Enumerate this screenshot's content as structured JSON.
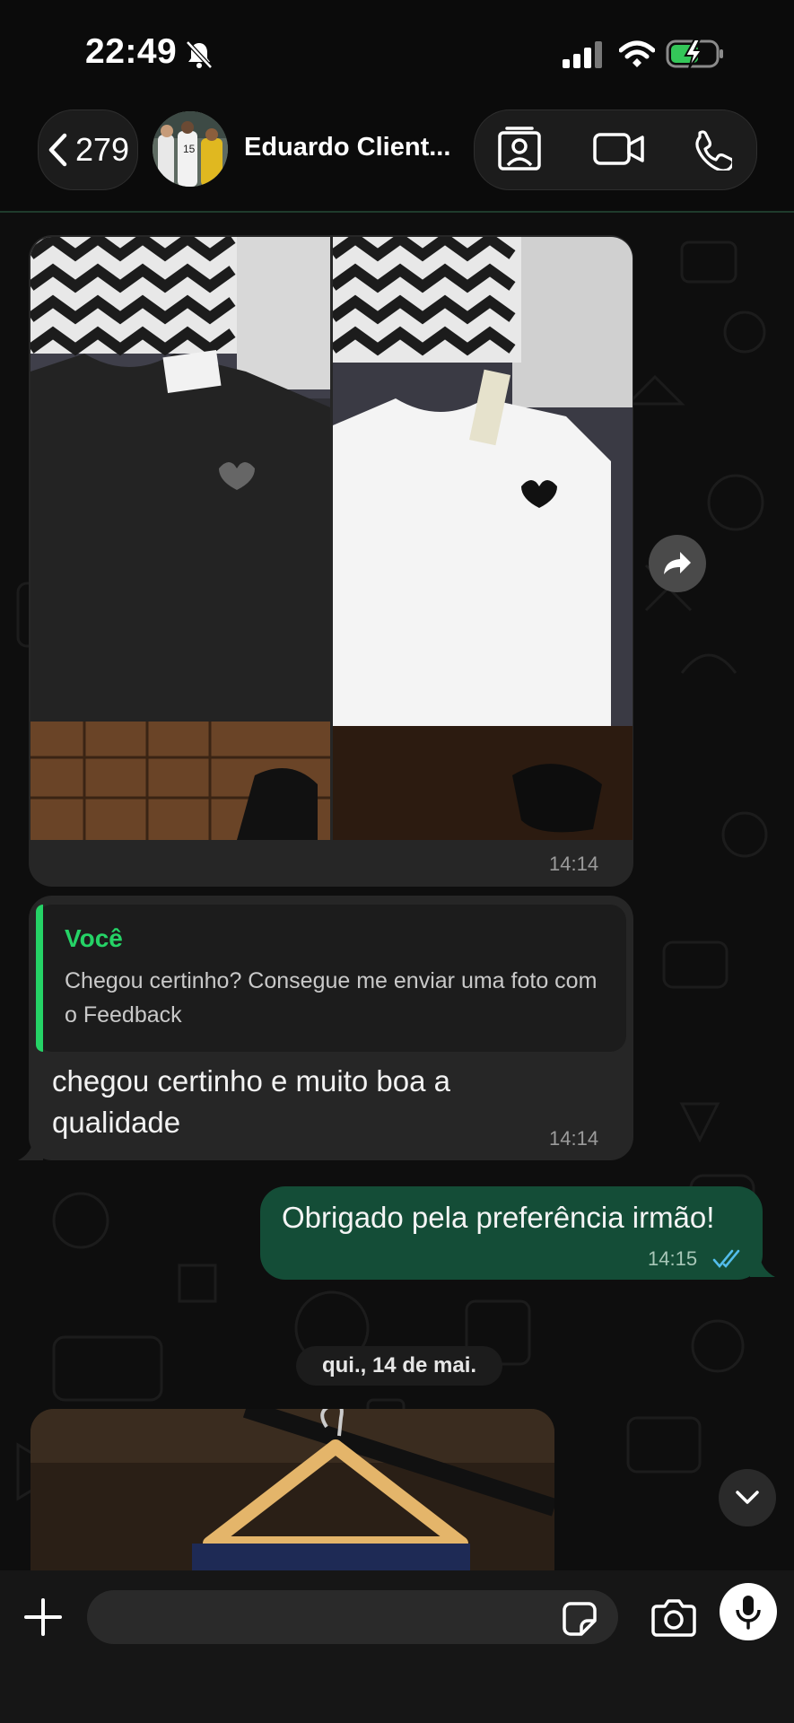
{
  "status_bar": {
    "time": "22:49",
    "icons": [
      "bell-slash-icon",
      "signal-icon",
      "wifi-icon",
      "battery-charging-icon"
    ]
  },
  "header": {
    "back_count": "279",
    "contact_name": "Eduardo Client...",
    "actions": [
      "contact-card-icon",
      "video-call-icon",
      "phone-icon"
    ]
  },
  "messages": [
    {
      "type": "image-album",
      "direction": "in",
      "time": "14:14"
    },
    {
      "type": "reply",
      "direction": "in",
      "quote_author": "Você",
      "quote_text": "Chegou certinho? Consegue me enviar uma foto com o Feedback",
      "text": "chegou certinho e muito boa a qualidade",
      "time": "14:14"
    },
    {
      "type": "text",
      "direction": "out",
      "text": "Obrigado pela preferência irmão!",
      "time": "14:15",
      "status": "read"
    }
  ],
  "date_separator": "qui., 14 de mai.",
  "colors": {
    "accent_green": "#25d366",
    "outgoing_bubble": "#144d37",
    "incoming_bubble": "#262626",
    "read_ticks": "#53bdeb"
  }
}
